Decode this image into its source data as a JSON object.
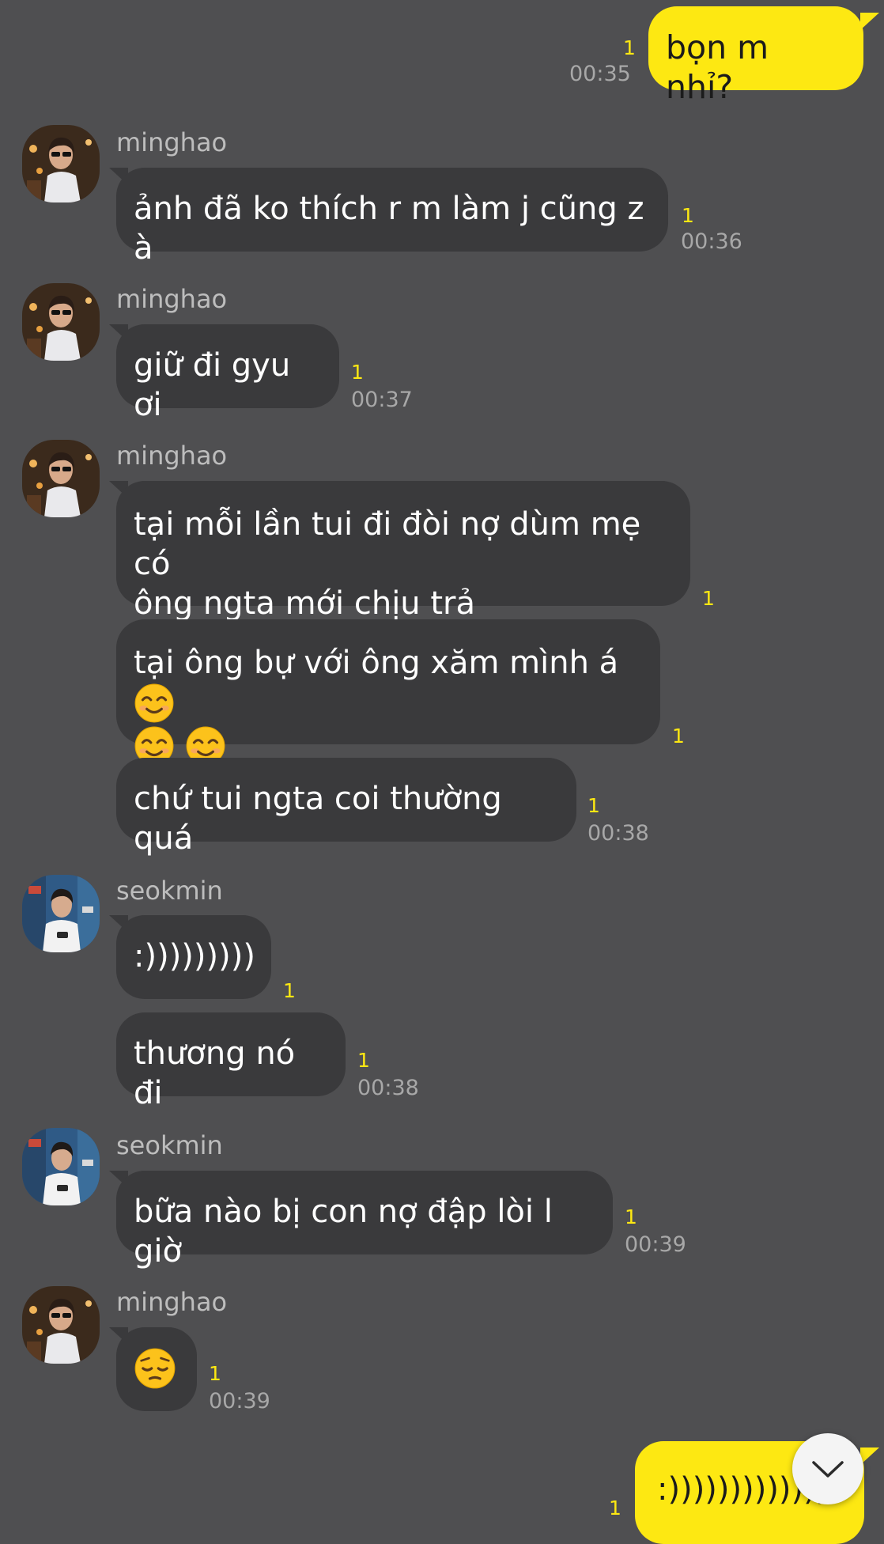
{
  "messages": {
    "m1": {
      "text": "bọn m nhỉ?",
      "read": "1",
      "time": "00:35"
    },
    "g1": {
      "sender": "minghao",
      "text": "ảnh đã ko thích r m làm j cũng z à",
      "read": "1",
      "time": "00:36"
    },
    "g2": {
      "sender": "minghao",
      "text": "giữ đi gyu ơi",
      "read": "1",
      "time": "00:37"
    },
    "g3": {
      "sender": "minghao",
      "b1_line1": "tại mỗi lần tui đi đòi nợ dùm mẹ có",
      "b1_line2": "ông ngta mới chịu trả",
      "b1_read": "1",
      "b2_line1": "tại ông bự với ông xăm mình á",
      "b2_read": "1",
      "b3": "chứ tui ngta coi thường quá",
      "b3_read": "1",
      "time": "00:38"
    },
    "g4": {
      "sender": "seokmin",
      "b1": ":)))))))))",
      "b1_read": "1",
      "b2": "thương nó đi",
      "b2_read": "1",
      "time": "00:38"
    },
    "g5": {
      "sender": "seokmin",
      "text": "bữa nào bị con nợ đập lòi l giờ",
      "read": "1",
      "time": "00:39"
    },
    "g6": {
      "sender": "minghao",
      "read": "1",
      "time": "00:39"
    },
    "m2": {
      "text": ":)))))))))))))",
      "read": "1"
    }
  },
  "icons": {
    "smile_emoji": "smiling-face-emoji",
    "pensive_emoji": "pensive-face-emoji",
    "scroll_down": "chevron-down-icon"
  },
  "colors": {
    "background": "#4f4f51",
    "incoming_bubble": "#3a3a3c",
    "outgoing_bubble": "#fde812",
    "read_count": "#fde812"
  }
}
